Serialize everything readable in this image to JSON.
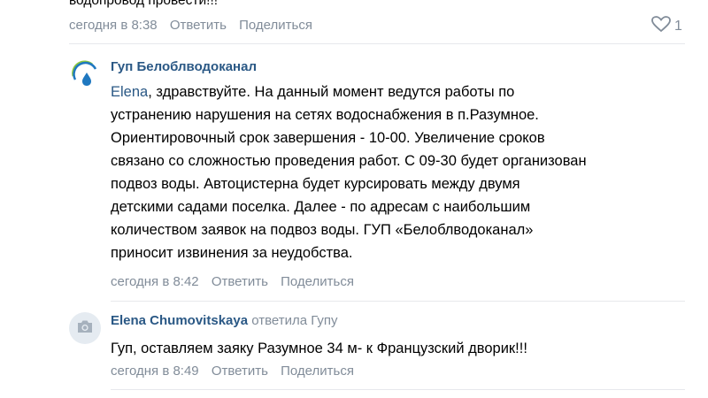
{
  "top_post": {
    "clipped_text": "водопровод провести!!!",
    "time": "сегодня в 8:38",
    "reply": "Ответить",
    "share": "Поделиться",
    "likes": "1"
  },
  "comments": [
    {
      "author": "Гуп Белоблводоканал",
      "mention": "Elena",
      "lines": [
        ", здравствуйте. На данный момент ведутся работы по",
        "устранению нарушения на сетях водоснабжения в п.Разумное.",
        "Ориентировочный срок завершения - 10-00. Увеличение сроков",
        "связано со сложностью проведения работ. С 09-30 будет организован",
        "подвоз воды. Автоцистерна будет курсировать между двумя",
        "детскими садами поселка. Далее - по адресам с наибольшим",
        "количеством заявок на подвоз воды. ГУП «Белоблводоканал»",
        "приносит извинения за неудобства."
      ],
      "time": "сегодня в 8:42",
      "reply": "Ответить",
      "share": "Поделиться"
    },
    {
      "author": "Elena Chumovitskaya",
      "reply_to": "ответила Гупу",
      "text": "Гуп, оставляем заяку Разумное 34 м- к Французский дворик!!!",
      "time": "сегодня в 8:49",
      "reply": "Ответить",
      "share": "Поделиться"
    }
  ],
  "icons": {
    "like": "heart-icon",
    "avatar1": "water-drop-logo-icon",
    "avatar2": "camera-icon"
  },
  "colors": {
    "link": "#2a5885",
    "meta": "#818c99",
    "divider": "#e7e8ec",
    "logo_blue": "#1f78c0",
    "logo_green": "#8cc63f"
  }
}
